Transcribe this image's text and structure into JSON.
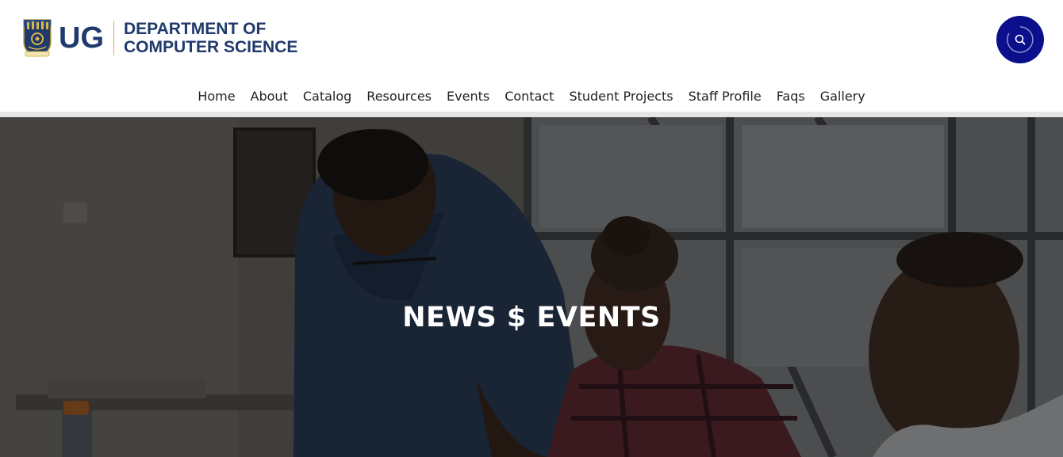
{
  "header": {
    "logo_short": "UG",
    "logo_dept_line1": "DEPARTMENT OF",
    "logo_dept_line2": "COMPUTER SCIENCE",
    "brand_color": "#1f3a6b",
    "search_button_color": "#0b0f8c",
    "search_icon": "search-icon"
  },
  "nav": {
    "items": [
      {
        "label": "Home"
      },
      {
        "label": "About"
      },
      {
        "label": "Catalog"
      },
      {
        "label": "Resources"
      },
      {
        "label": "Events"
      },
      {
        "label": "Contact"
      },
      {
        "label": "Student Projects"
      },
      {
        "label": "Staff Profile"
      },
      {
        "label": "Faqs"
      },
      {
        "label": "Gallery"
      }
    ]
  },
  "hero": {
    "title": "NEWS $ EVENTS"
  }
}
